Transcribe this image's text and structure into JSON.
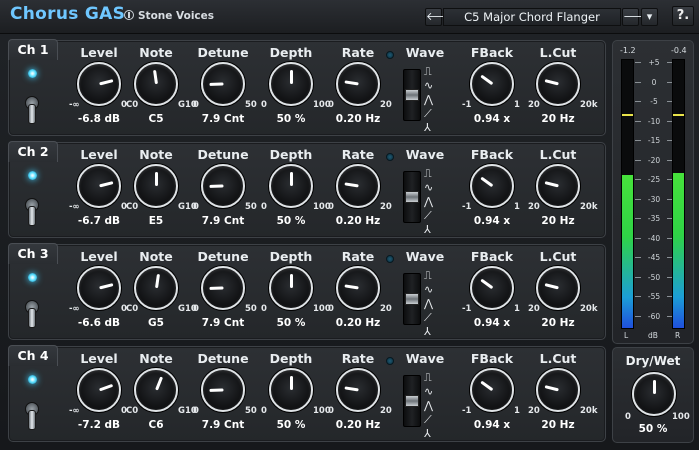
{
  "header": {
    "title": "Chorus GAS",
    "vendor": "Stone Voices",
    "prev_label": "🡐",
    "next_label": "🡒",
    "menu_label": "▾",
    "preset": "C5 Major Chord Flanger",
    "help_label": "?."
  },
  "labels": {
    "level": "Level",
    "note": "Note",
    "detune": "Detune",
    "depth": "Depth",
    "rate": "Rate",
    "wave": "Wave",
    "fback": "FBack",
    "lcut": "L.Cut"
  },
  "ranges": {
    "level": [
      "-∞",
      "0"
    ],
    "note": [
      "C0",
      "G10"
    ],
    "detune": [
      "0",
      "50"
    ],
    "depth": [
      "0",
      "100"
    ],
    "rate": [
      "0",
      "20"
    ],
    "fback": [
      "-1",
      "1"
    ],
    "lcut": [
      "20",
      "20k"
    ]
  },
  "channels": [
    {
      "name": "Ch 1",
      "enabled": true,
      "level": "-6.8 dB",
      "level_pos": 0.78,
      "note": "C5",
      "note_pos": 0.47,
      "detune": "7.9 Cnt",
      "detune_pos": 0.16,
      "depth": "50 %",
      "depth_pos": 0.5,
      "rate": "0.20 Hz",
      "rate_pos": 0.2,
      "wave_pos": 0.5,
      "fback": "0.94 x",
      "fback_pos": 0.3,
      "lcut": "20 Hz",
      "lcut_pos": 0.22
    },
    {
      "name": "Ch 2",
      "enabled": true,
      "level": "-6.7 dB",
      "level_pos": 0.78,
      "note": "E5",
      "note_pos": 0.5,
      "detune": "7.9 Cnt",
      "detune_pos": 0.16,
      "depth": "50 %",
      "depth_pos": 0.5,
      "rate": "0.20 Hz",
      "rate_pos": 0.2,
      "wave_pos": 0.5,
      "fback": "0.94 x",
      "fback_pos": 0.3,
      "lcut": "20 Hz",
      "lcut_pos": 0.22
    },
    {
      "name": "Ch 3",
      "enabled": true,
      "level": "-6.6 dB",
      "level_pos": 0.78,
      "note": "G5",
      "note_pos": 0.53,
      "detune": "7.9 Cnt",
      "detune_pos": 0.16,
      "depth": "50 %",
      "depth_pos": 0.5,
      "rate": "0.20 Hz",
      "rate_pos": 0.2,
      "wave_pos": 0.5,
      "fback": "0.94 x",
      "fback_pos": 0.3,
      "lcut": "20 Hz",
      "lcut_pos": 0.22
    },
    {
      "name": "Ch 4",
      "enabled": true,
      "level": "-7.2 dB",
      "level_pos": 0.76,
      "note": "C6",
      "note_pos": 0.58,
      "detune": "7.9 Cnt",
      "detune_pos": 0.16,
      "depth": "50 %",
      "depth_pos": 0.5,
      "rate": "0.20 Hz",
      "rate_pos": 0.2,
      "wave_pos": 0.5,
      "fback": "0.94 x",
      "fback_pos": 0.3,
      "lcut": "20 Hz",
      "lcut_pos": 0.22
    }
  ],
  "wave_icons": [
    "square-wave-icon",
    "sine-wave-icon",
    "triangle-wave-icon",
    "saw-wave-icon",
    "random-wave-icon"
  ],
  "wave_glyphs": [
    "⎍",
    "∿",
    "⋀",
    "⟋",
    "⅄"
  ],
  "meter": {
    "peak_left": "-1.2",
    "peak_right": "-0.4",
    "scale": [
      "+5",
      "0",
      "-5",
      "-10",
      "-15",
      "-20",
      "-25",
      "-30",
      "-35",
      "-40",
      "-45",
      "-50",
      "-55",
      "-60"
    ],
    "left_level": 0.57,
    "right_level": 0.58,
    "left_peak_pos": 0.79,
    "right_peak_pos": 0.79,
    "label_left": "L",
    "label_unit": "dB",
    "label_right": "R"
  },
  "drywet": {
    "label": "Dry/Wet",
    "min": "0",
    "max": "100",
    "value": "50 %",
    "pos": 0.5
  },
  "colors": {
    "accent": "#6fc7ff",
    "led_on": "#3fd1ff"
  }
}
